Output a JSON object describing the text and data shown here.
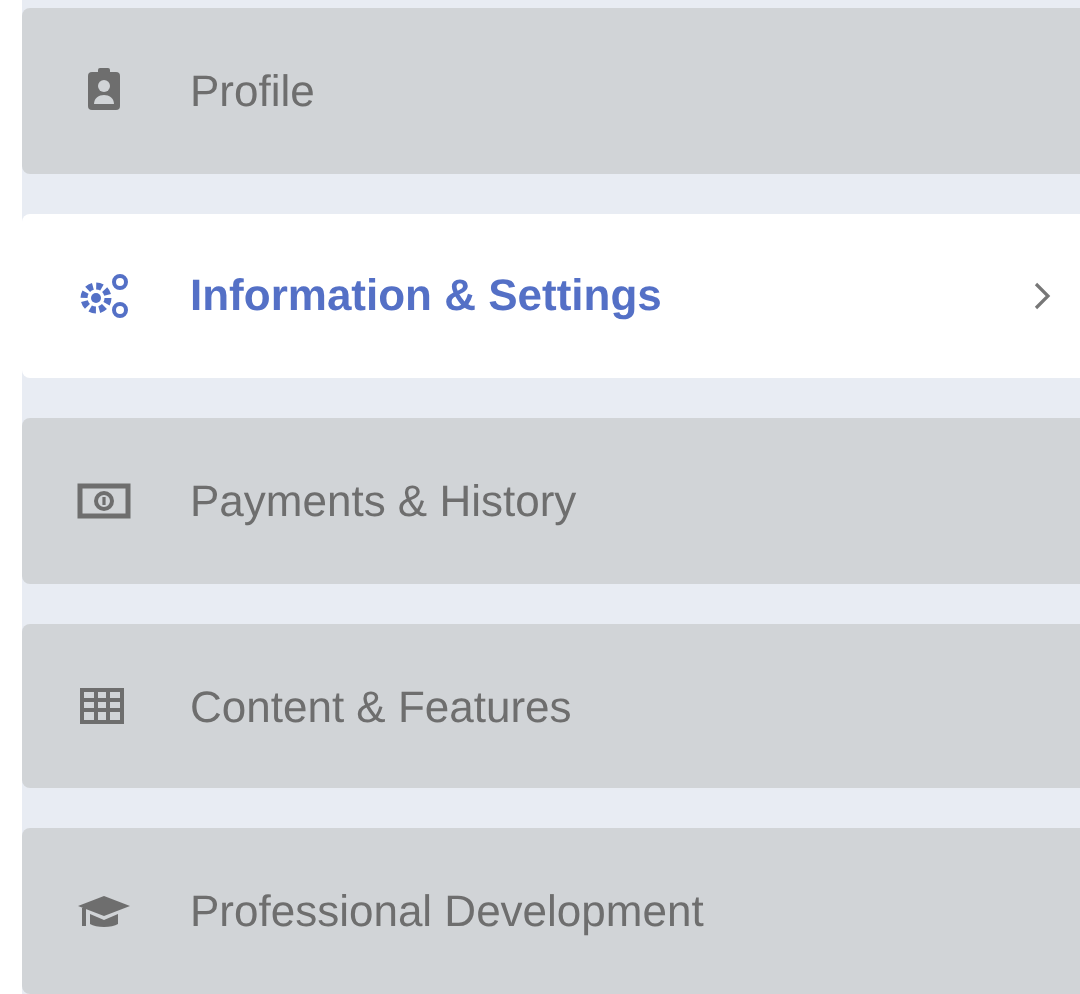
{
  "menu": {
    "items": [
      {
        "label": "Profile",
        "selected": false
      },
      {
        "label": "Information & Settings",
        "selected": true
      },
      {
        "label": "Payments & History",
        "selected": false
      },
      {
        "label": "Content & Features",
        "selected": false
      },
      {
        "label": "Professional Development",
        "selected": false
      }
    ]
  }
}
